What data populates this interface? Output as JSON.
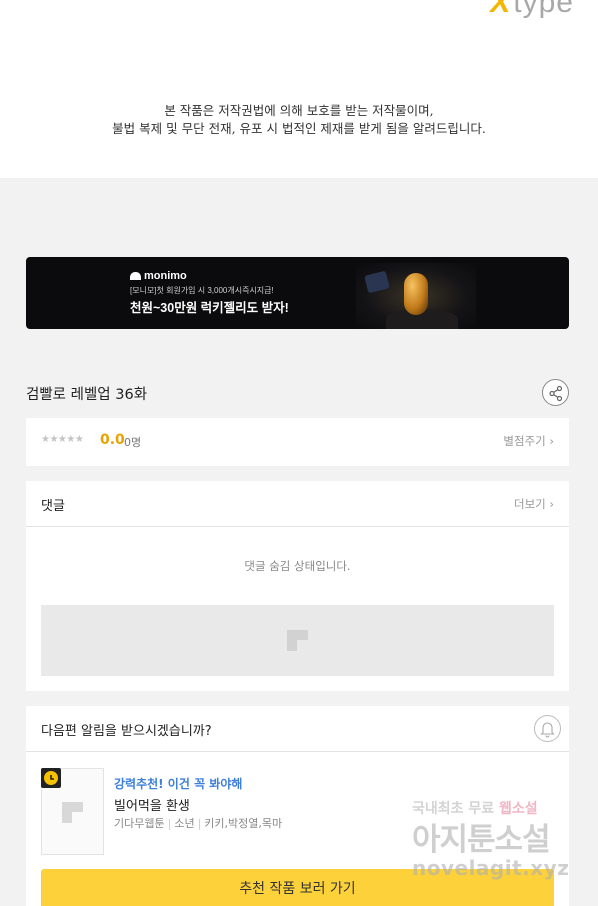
{
  "header": {
    "logo_mark": "X",
    "logo_text": "type",
    "copyright_line1": "본 작품은 저작권법에 의해 보호를 받는 저작물이며,",
    "copyright_line2": "불법 복제 및 무단 전재, 유포 시 법적인 제재를 받게 됨을 알려드립니다."
  },
  "banner": {
    "brand": "monimo",
    "small_text": "[모니모]첫 회원가입 시 3,000개시즉시지급!",
    "big_text": "천원~30만원 럭키젤리도 받자!"
  },
  "episode": {
    "title": "검빨로 레벨업 36화",
    "stars": "★★★★★",
    "score": "0.0",
    "rating_count": "0명",
    "rate_link": "별점주기 ›"
  },
  "comments": {
    "title": "댓글",
    "more": "더보기 ›",
    "hidden_message": "댓글 숨김 상태입니다."
  },
  "notify": {
    "question": "다음편 알림을 받으시겠습니까?"
  },
  "recommendation": {
    "tag": "강력추천! 이건 꼭 봐야해",
    "title": "빌어먹을 환생",
    "genre": "기다무웹툰",
    "category": "소년",
    "authors": "키키,박정열,목마",
    "cta": "추천 작품 보러 가기"
  },
  "watermark": {
    "line1_prefix": "국내최초 무료 ",
    "line1_highlight": "웹소설",
    "line2": "아지툰소설",
    "line3": "novelagit.xyz"
  },
  "colors": {
    "accent_yellow": "#fcd13a",
    "score_yellow": "#e8a300",
    "link_blue": "#3d7fd9",
    "page_bg": "#f2f2f2"
  }
}
